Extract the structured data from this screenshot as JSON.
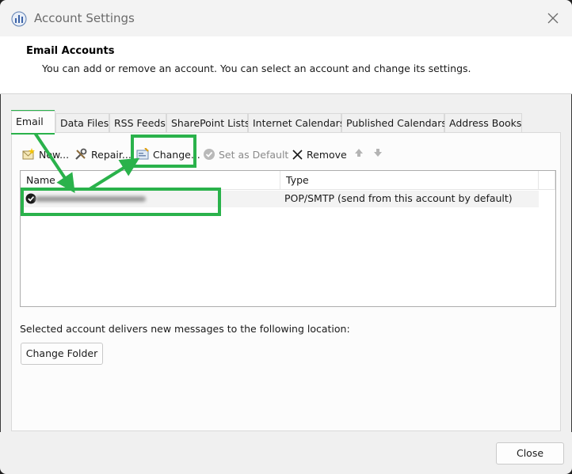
{
  "window": {
    "title": "Account Settings"
  },
  "header": {
    "title": "Email Accounts",
    "description": "You can add or remove an account. You can select an account and change its settings."
  },
  "tabs": [
    {
      "label": "Email"
    },
    {
      "label": "Data Files"
    },
    {
      "label": "RSS Feeds"
    },
    {
      "label": "SharePoint Lists"
    },
    {
      "label": "Internet Calendars"
    },
    {
      "label": "Published Calendars"
    },
    {
      "label": "Address Books"
    }
  ],
  "toolbar": {
    "new_label": "New...",
    "repair_label": "Repair...",
    "change_label": "Change...",
    "set_default_label": "Set as Default",
    "remove_label": "Remove"
  },
  "accounts_list": {
    "columns": [
      "Name",
      "Type"
    ],
    "rows": [
      {
        "name": "",
        "type": "POP/SMTP (send from this account by default)",
        "is_default": true
      }
    ]
  },
  "delivery": {
    "label": "Selected account delivers new messages to the following location:",
    "change_folder_label": "Change Folder"
  },
  "footer": {
    "close_label": "Close"
  },
  "colors": {
    "annotation_green": "#2ab24b",
    "default_check": "#1a1a1a"
  }
}
